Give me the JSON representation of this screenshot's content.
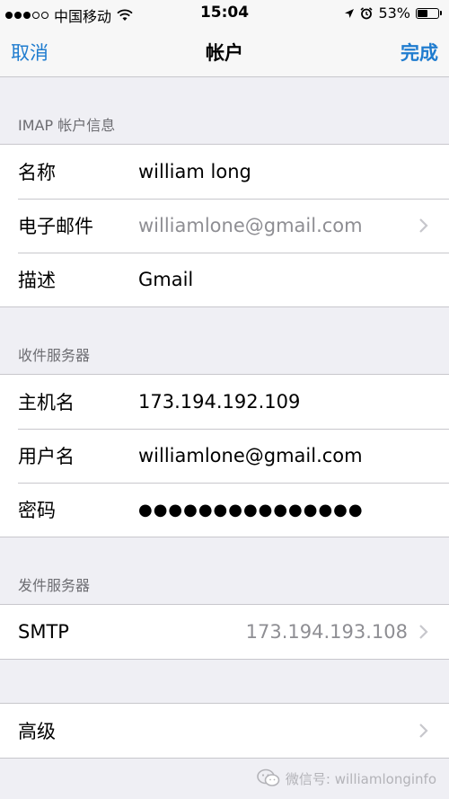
{
  "statusbar": {
    "carrier": "中国移动",
    "time": "15:04",
    "battery_percent": "53%",
    "battery_level": 0.53
  },
  "nav": {
    "cancel": "取消",
    "title": "帐户",
    "done": "完成"
  },
  "imap_section": {
    "header": "IMAP 帐户信息",
    "rows": [
      {
        "label": "名称",
        "value": "william long"
      },
      {
        "label": "电子邮件",
        "value": "williamlone@gmail.com"
      },
      {
        "label": "描述",
        "value": "Gmail"
      }
    ]
  },
  "incoming_section": {
    "header": "收件服务器",
    "rows": [
      {
        "label": "主机名",
        "value": "173.194.192.109"
      },
      {
        "label": "用户名",
        "value": "williamlone@gmail.com"
      },
      {
        "label": "密码",
        "value": "●●●●●●●●●●●●●●●"
      }
    ]
  },
  "outgoing_section": {
    "header": "发件服务器",
    "rows": [
      {
        "label": "SMTP",
        "value": "173.194.193.108"
      }
    ]
  },
  "advanced": {
    "label": "高级"
  },
  "watermark": {
    "text": "微信号: williamlonginfo"
  },
  "colors": {
    "accent": "#1f7ccf",
    "background": "#efeff4",
    "separator": "#c8c7cc"
  }
}
